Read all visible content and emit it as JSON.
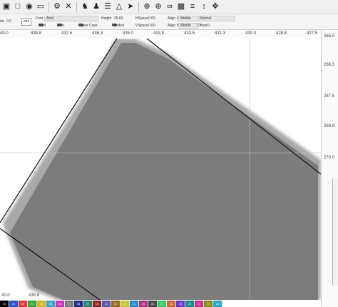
{
  "toolbar": {
    "icons": [
      "folder-icon",
      "select-icon",
      "camera-icon",
      "monitor-icon",
      "settings-icon",
      "tools-icon",
      "users-icon",
      "user-icon",
      "align-icon",
      "warning-icon",
      "send-icon",
      "add-icon",
      "position-icon",
      "link-icon",
      "group-icon",
      "distribute-icon",
      "measure-icon"
    ]
  },
  "props": {
    "angle_label": "rle",
    "angle_value": "0.0",
    "unit": "mm",
    "font_label": "Font",
    "font_value": "Arial",
    "height_label": "Height",
    "height_value": "25.00",
    "hspace_label": "HSpace",
    "hspace_value": "0.00",
    "vspace_label": "VSpace",
    "vspace_value": "0.00",
    "align_x_label": "Align X",
    "align_x_value": "Middle",
    "align_y_label": "Align Y",
    "align_y_value": "Middle",
    "mode_value": "Normal",
    "offset_label": "Offset",
    "offset_value": "0",
    "bold_label": "Bold",
    "italic_label": "Italic",
    "upper_label": "Upper Case",
    "welded_label": "Welded"
  },
  "ruler_top": [
    "40.0",
    "438.8",
    "437.5",
    "436.3",
    "435.0",
    "433.8",
    "433.5",
    "431.3",
    "430.0",
    "428.8",
    "427.5"
  ],
  "ruler_right": [
    "265.0",
    "266.3",
    "267.5",
    "268.8",
    "270.0"
  ],
  "ruler_bottom": [
    "40.0",
    "438.8"
  ],
  "colors": {
    "shape_fill": "#7c7c7c",
    "shape_edge": "#a9a9a9",
    "outline": "#111111"
  },
  "palette": [
    {
      "label": "00",
      "color": "#000000"
    },
    {
      "label": "01",
      "color": "#2a54c9"
    },
    {
      "label": "02",
      "color": "#d83b3b"
    },
    {
      "label": "03",
      "color": "#3aa33a"
    },
    {
      "label": "04",
      "color": "#d6b52a"
    },
    {
      "label": "05",
      "color": "#3fa7c8"
    },
    {
      "label": "06",
      "color": "#c93ab5"
    },
    {
      "label": "07",
      "color": "#7a7a7a"
    },
    {
      "label": "08",
      "color": "#1f2f8a"
    },
    {
      "label": "09",
      "color": "#2f7d6e"
    },
    {
      "label": "10",
      "color": "#8a2a2a"
    },
    {
      "label": "11",
      "color": "#5a5aa8"
    },
    {
      "label": "12",
      "color": "#9a6a2a"
    },
    {
      "label": "13",
      "color": "#c8c832"
    },
    {
      "label": "14",
      "color": "#2a8ac8"
    },
    {
      "label": "15",
      "color": "#a83a7a"
    },
    {
      "label": "16",
      "color": "#4a4a4a"
    },
    {
      "label": "17",
      "color": "#3fc86a"
    },
    {
      "label": "18",
      "color": "#c86a3a"
    },
    {
      "label": "19",
      "color": "#6a3ac8"
    },
    {
      "label": "20",
      "color": "#1a8a8a"
    },
    {
      "label": "21",
      "color": "#c8328a"
    },
    {
      "label": "22",
      "color": "#8a8a1a"
    },
    {
      "label": "23",
      "color": "#32a8c8"
    }
  ]
}
